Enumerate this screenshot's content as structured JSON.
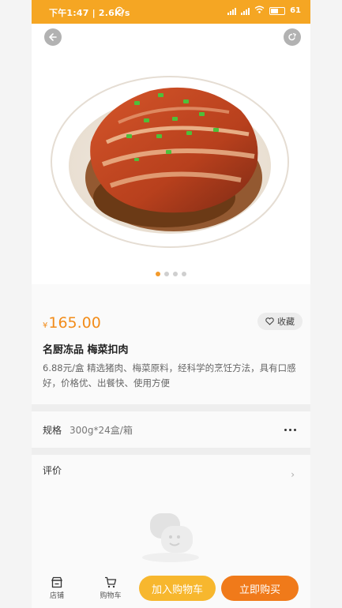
{
  "status_bar": {
    "time_speed": "下午1:47 | 2.6K/s",
    "battery": "61"
  },
  "product": {
    "currency": "¥",
    "price": "165.00",
    "favorite_label": "收藏",
    "title": "名厨冻品  梅菜扣肉",
    "description": "6.88元/盒  精选猪肉、梅菜原料，经科学的烹饪方法，具有口感好，价格优、出餐快、使用方便"
  },
  "carousel": {
    "count": 4,
    "active": 0
  },
  "spec": {
    "label": "规格",
    "value": "300g*24盒/箱"
  },
  "review": {
    "label": "评价"
  },
  "bottom_bar": {
    "store_label": "店铺",
    "cart_label": "购物车",
    "add_to_cart": "加入购物车",
    "buy_now": "立即购买"
  },
  "colors": {
    "accent": "#f28c1a",
    "status_bar": "#f5a623",
    "cart_button": "#f7b72e",
    "buy_button": "#f07a1a"
  }
}
